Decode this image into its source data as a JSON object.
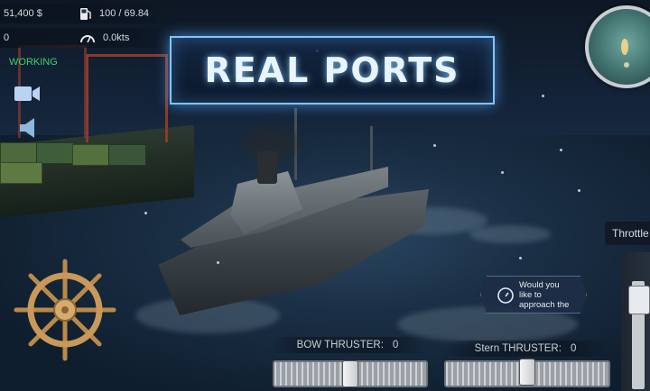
{
  "hud": {
    "money": "51,400 $",
    "fuel_icon": "fuel-pump-icon",
    "fuel": "100 / 69.84",
    "counter": "0",
    "speed_icon": "speedometer-icon",
    "speed": "0.0kts",
    "status": "WORKING",
    "status_color": "#3bd36b"
  },
  "controls": {
    "camera_icon": "video-camera-icon",
    "sound_icon": "speaker-icon",
    "wheel_icon": "ship-wheel-icon"
  },
  "banner": {
    "title": "REAL PORTS"
  },
  "minimap": {
    "icon": "radar-minimap-icon"
  },
  "throttle": {
    "label": "Throttle",
    "level": 0.05
  },
  "approach": {
    "icon": "speedometer-icon",
    "text_line1": "Would you",
    "text_line2": "like to",
    "text_line3": "approach the"
  },
  "bow_thruster": {
    "label": "BOW THRUSTER:",
    "value": "0",
    "level": 0.5
  },
  "stern_thruster": {
    "label": "Stern THRUSTER:",
    "value": "0",
    "level": 0.5
  },
  "colors": {
    "accent": "#7fc6ff",
    "working": "#3bd36b"
  }
}
